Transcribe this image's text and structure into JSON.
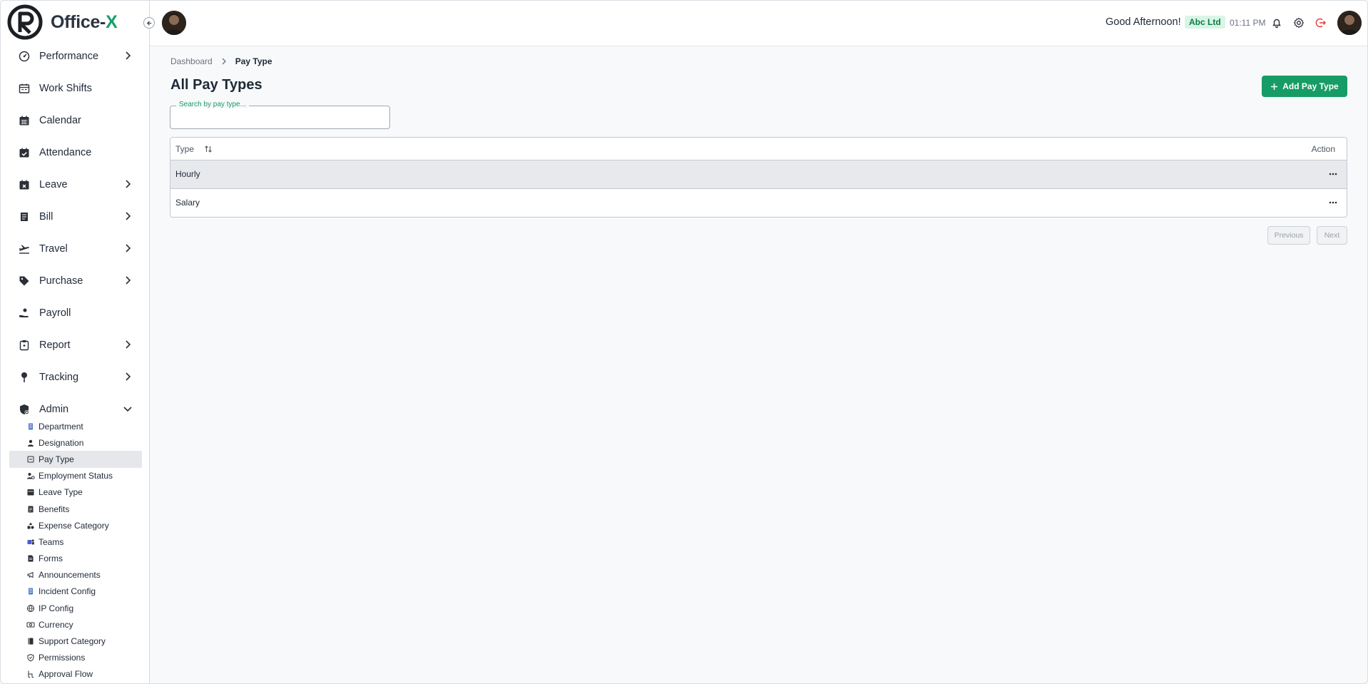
{
  "app": {
    "name_main": "Office-",
    "name_accent": "X"
  },
  "header": {
    "greeting": "Good Afternoon!",
    "company": "Abc Ltd",
    "time": "01:11 PM",
    "icons": [
      "bell-icon",
      "gear-icon",
      "logout-icon"
    ]
  },
  "sidebar": {
    "items": [
      {
        "label": "Performance",
        "icon": "gauge-icon",
        "has_chevron": true
      },
      {
        "label": "Work Shifts",
        "icon": "shift-calendar-icon",
        "has_chevron": false
      },
      {
        "label": "Calendar",
        "icon": "calendar-icon",
        "has_chevron": false
      },
      {
        "label": "Attendance",
        "icon": "calendar-check-icon",
        "has_chevron": false
      },
      {
        "label": "Leave",
        "icon": "calendar-x-icon",
        "has_chevron": true
      },
      {
        "label": "Bill",
        "icon": "bill-icon",
        "has_chevron": true
      },
      {
        "label": "Travel",
        "icon": "plane-icon",
        "has_chevron": true
      },
      {
        "label": "Purchase",
        "icon": "tag-icon",
        "has_chevron": true
      },
      {
        "label": "Payroll",
        "icon": "hand-coin-icon",
        "has_chevron": false
      },
      {
        "label": "Report",
        "icon": "clipboard-icon",
        "has_chevron": true
      },
      {
        "label": "Tracking",
        "icon": "pin-icon",
        "has_chevron": true
      },
      {
        "label": "Admin",
        "icon": "admin-icon",
        "has_chevron": true,
        "expanded": true
      }
    ],
    "admin_items": [
      {
        "label": "Department",
        "icon": "building-icon"
      },
      {
        "label": "Designation",
        "icon": "person-icon"
      },
      {
        "label": "Pay Type",
        "icon": "paytype-icon",
        "active": true
      },
      {
        "label": "Employment Status",
        "icon": "user-status-icon"
      },
      {
        "label": "Leave Type",
        "icon": "leave-type-icon"
      },
      {
        "label": "Benefits",
        "icon": "benefits-icon"
      },
      {
        "label": "Expense Category",
        "icon": "shapes-icon"
      },
      {
        "label": "Teams",
        "icon": "teams-icon"
      },
      {
        "label": "Forms",
        "icon": "form-icon"
      },
      {
        "label": "Announcements",
        "icon": "megaphone-icon"
      },
      {
        "label": "Incident Config",
        "icon": "incident-icon"
      },
      {
        "label": "IP Config",
        "icon": "globe-icon"
      },
      {
        "label": "Currency",
        "icon": "money-icon"
      },
      {
        "label": "Support Category",
        "icon": "book-icon"
      },
      {
        "label": "Permissions",
        "icon": "shield-icon"
      },
      {
        "label": "Approval Flow",
        "icon": "flow-icon"
      }
    ]
  },
  "breadcrumb": {
    "root": "Dashboard",
    "current": "Pay Type"
  },
  "page": {
    "title": "All Pay Types",
    "add_button": "Add Pay Type",
    "search_placeholder": "Search by pay type..."
  },
  "table": {
    "columns": [
      "Type",
      "Action"
    ],
    "rows": [
      {
        "type": "Hourly",
        "highlighted": true
      },
      {
        "type": "Salary",
        "highlighted": false
      }
    ]
  },
  "pagination": {
    "previous": "Previous",
    "next": "Next"
  },
  "colors": {
    "accent": "#169c64",
    "badge_bg": "#d8f5e5",
    "logout": "#e53935"
  }
}
